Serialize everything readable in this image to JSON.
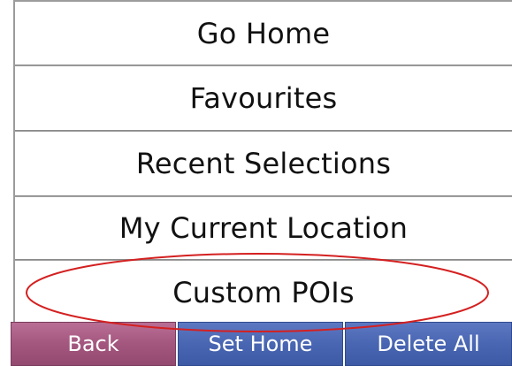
{
  "menu": {
    "items": [
      {
        "label": "Go Home"
      },
      {
        "label": "Favourites"
      },
      {
        "label": "Recent Selections"
      },
      {
        "label": "My Current Location"
      },
      {
        "label": "Custom POIs"
      }
    ]
  },
  "toolbar": {
    "back_label": "Back",
    "set_home_label": "Set Home",
    "delete_all_label": "Delete All"
  },
  "colors": {
    "back_button": "#a4577e",
    "action_button": "#4966b2",
    "highlight_ring": "#d42020"
  }
}
